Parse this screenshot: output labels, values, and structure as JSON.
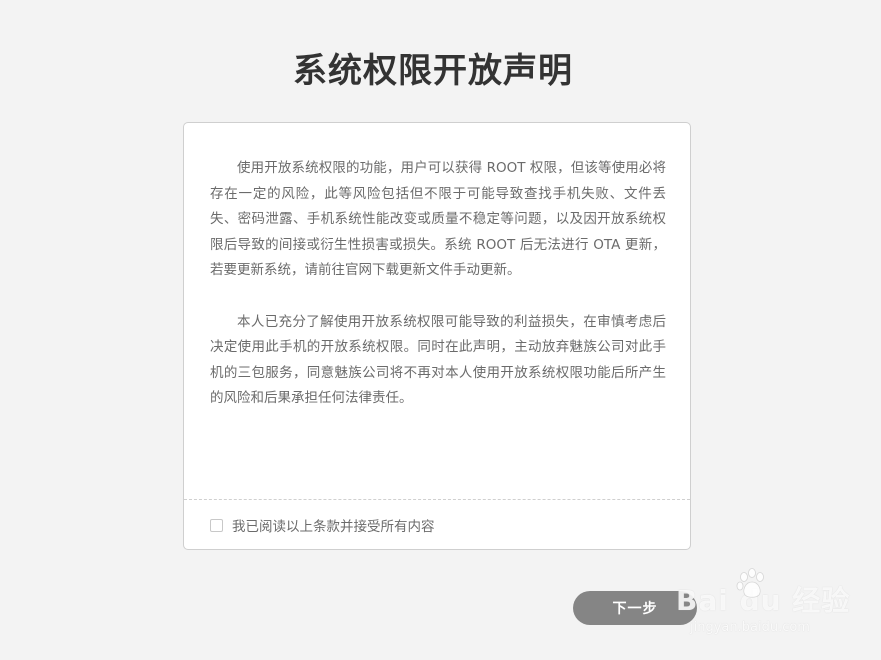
{
  "header": {
    "title": "系统权限开放声明"
  },
  "statement": {
    "paragraphs": [
      "使用开放系统权限的功能，用户可以获得 ROOT 权限，但该等使用必将存在一定的风险，此等风险包括但不限于可能导致查找手机失败、文件丢失、密码泄露、手机系统性能改变或质量不稳定等问题，以及因开放系统权限后导致的间接或衍生性损害或损失。系统 ROOT 后无法进行 OTA 更新，若要更新系统，请前往官网下载更新文件手动更新。",
      "本人已充分了解使用开放系统权限可能导致的利益损失，在审慎考虑后决定使用此手机的开放系统权限。同时在此声明，主动放弃魅族公司对此手机的三包服务，同意魅族公司将不再对本人使用开放系统权限功能后所产生的风险和后果承担任何法律责任。"
    ],
    "agree_label": "我已阅读以上条款并接受所有内容",
    "agree_checked": false
  },
  "footer": {
    "next_label": "下一步"
  },
  "watermark": {
    "logo_text": "Bai  du 经验",
    "site_text": "jingyan.baidu.com"
  },
  "colors": {
    "background": "#f3f3f3",
    "card": "#ffffff",
    "title": "#333333",
    "body_text": "#6b6b6b",
    "button": "#858585"
  }
}
